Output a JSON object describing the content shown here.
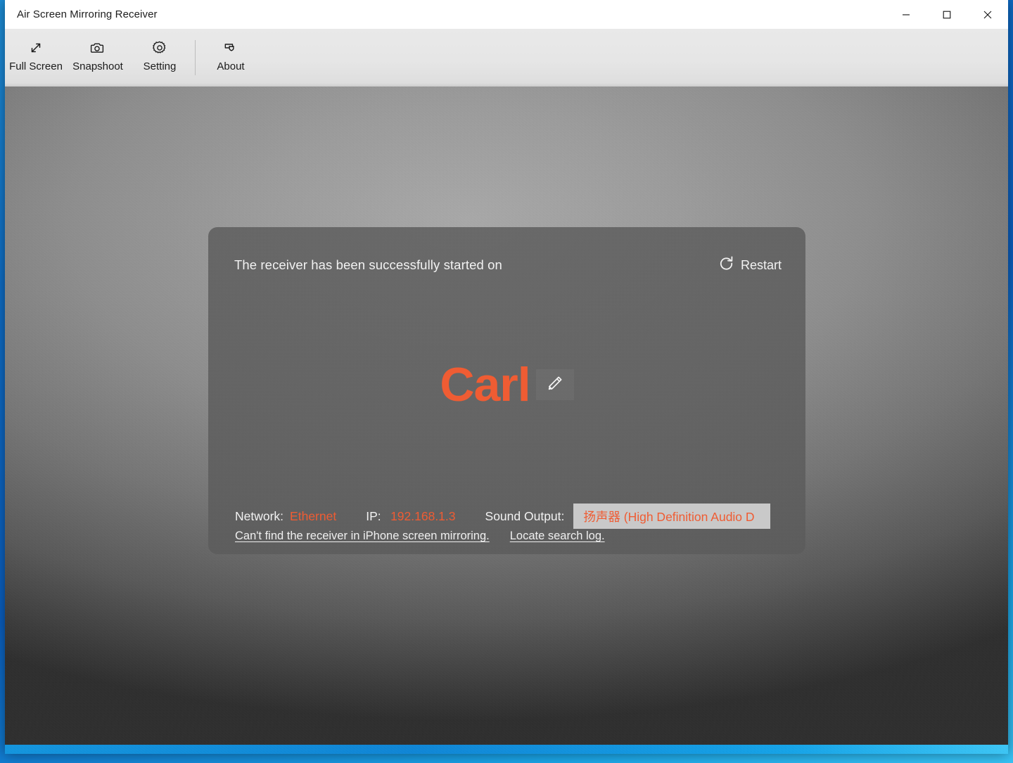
{
  "window": {
    "title": "Air Screen Mirroring Receiver",
    "controls": {
      "minimize": "minimize-icon",
      "maximize": "maximize-icon",
      "close": "close-icon"
    }
  },
  "toolbar": {
    "items": [
      {
        "label": "Full Screen",
        "icon": "fullscreen-icon"
      },
      {
        "label": "Snapshoot",
        "icon": "camera-icon"
      },
      {
        "label": "Setting",
        "icon": "gear-icon"
      },
      {
        "label": "About",
        "icon": "about-shield-icon"
      }
    ]
  },
  "card": {
    "status_text": "The receiver has been successfully started on",
    "restart_label": "Restart",
    "restart_icon": "refresh-circle-icon",
    "device_name": "Carl",
    "edit_icon": "pencil-icon",
    "info": {
      "network_label": "Network:",
      "network_value": "Ethernet",
      "ip_label": "IP:",
      "ip_value": "192.168.1.3",
      "sound_label": "Sound Output:",
      "sound_value": "扬声器 (High Definition Audio D"
    },
    "links": {
      "help": "Can't find the receiver in iPhone screen mirroring.",
      "log": "Locate search log."
    }
  },
  "colors": {
    "accent_orange": "#EF5C33",
    "card_bg": "rgba(92,92,92,.82)",
    "toolbar_bg": "#E6E6E6",
    "desktop_blue": "#0F6FC8"
  }
}
